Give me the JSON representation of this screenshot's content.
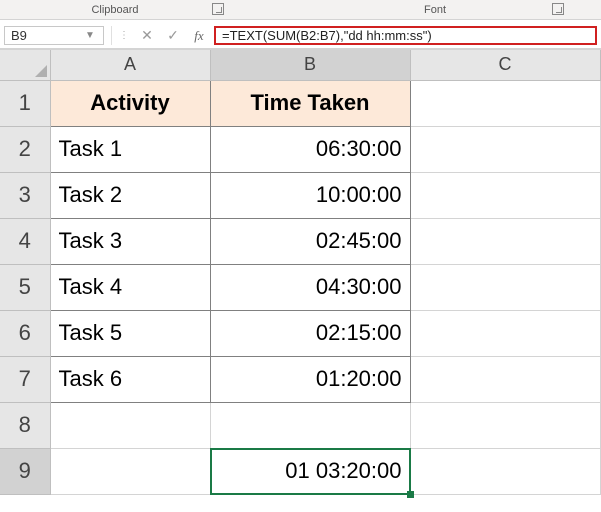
{
  "ribbon": {
    "clipboard_label": "Clipboard",
    "font_label": "Font"
  },
  "formula_bar": {
    "name_box": "B9",
    "cancel_glyph": "✕",
    "enter_glyph": "✓",
    "fx_label": "fx",
    "formula": "=TEXT(SUM(B2:B7),\"dd hh:mm:ss\")"
  },
  "columns": [
    "A",
    "B",
    "C"
  ],
  "rows": [
    "1",
    "2",
    "3",
    "4",
    "5",
    "6",
    "7",
    "8",
    "9"
  ],
  "active_cell": {
    "col": "B",
    "row": "9"
  },
  "headers": {
    "A": "Activity",
    "B": "Time Taken"
  },
  "data": [
    {
      "activity": "Task 1",
      "time": "06:30:00"
    },
    {
      "activity": "Task 2",
      "time": "10:00:00"
    },
    {
      "activity": "Task 3",
      "time": "02:45:00"
    },
    {
      "activity": "Task 4",
      "time": "04:30:00"
    },
    {
      "activity": "Task 5",
      "time": "02:15:00"
    },
    {
      "activity": "Task 6",
      "time": "01:20:00"
    }
  ],
  "result": "01 03:20:00"
}
